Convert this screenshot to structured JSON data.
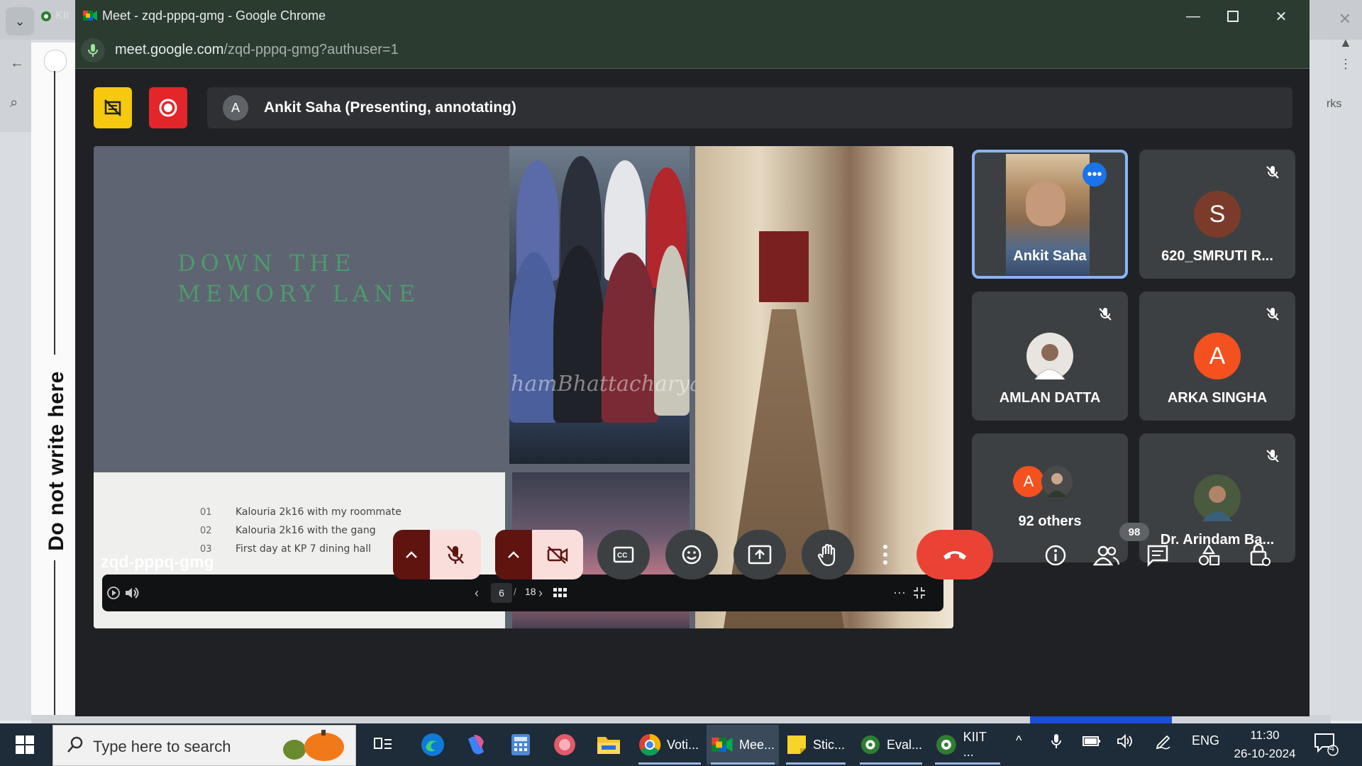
{
  "chrome": {
    "tab_partial": "KII",
    "title": "Meet - zqd-pppq-gmg - Google Chrome",
    "url_host": "meet.google.com",
    "url_path": "/zqd-pppq-gmg?authuser=1"
  },
  "background": {
    "vertical_text": "Do not write here",
    "partial_text": "rks"
  },
  "meet": {
    "presenter_initial": "A",
    "presenter_text": "Ankit Saha (Presenting, annotating)",
    "meeting_code": "zqd-pppq-gmg",
    "participants_count": "98",
    "slide": {
      "title_line1": "DOWN THE",
      "title_line2": "MEMORY LANE",
      "items": [
        {
          "num": "01",
          "text": "Kalouria 2k16 with my roommate"
        },
        {
          "num": "02",
          "text": "Kalouria 2k16 with the gang"
        },
        {
          "num": "03",
          "text": "First day at KP 7 dining hall"
        }
      ],
      "watermark": "hamBhattacharya©",
      "current_page": "6",
      "page_sep": "/",
      "total_pages": "18"
    },
    "tiles": [
      {
        "name": "Ankit Saha"
      },
      {
        "name": "620_SMRUTI R...",
        "initial": "S",
        "color": "#7b3b2b"
      },
      {
        "name": "AMLAN DATTA"
      },
      {
        "name": "ARKA SINGHA",
        "initial": "A",
        "color": "#f4511e"
      },
      {
        "name": "92 others",
        "initial": "A",
        "color": "#f4511e"
      },
      {
        "name": "Dr. Arindam Ba..."
      }
    ]
  },
  "taskbar": {
    "search_placeholder": "Type here to search",
    "apps": [
      {
        "label": "Voti..."
      },
      {
        "label": "Mee..."
      },
      {
        "label": "Stic..."
      },
      {
        "label": "Eval..."
      },
      {
        "label": "KIIT ..."
      }
    ],
    "language": "ENG",
    "time": "11:30",
    "date": "26-10-2024",
    "notification_count": "4"
  }
}
